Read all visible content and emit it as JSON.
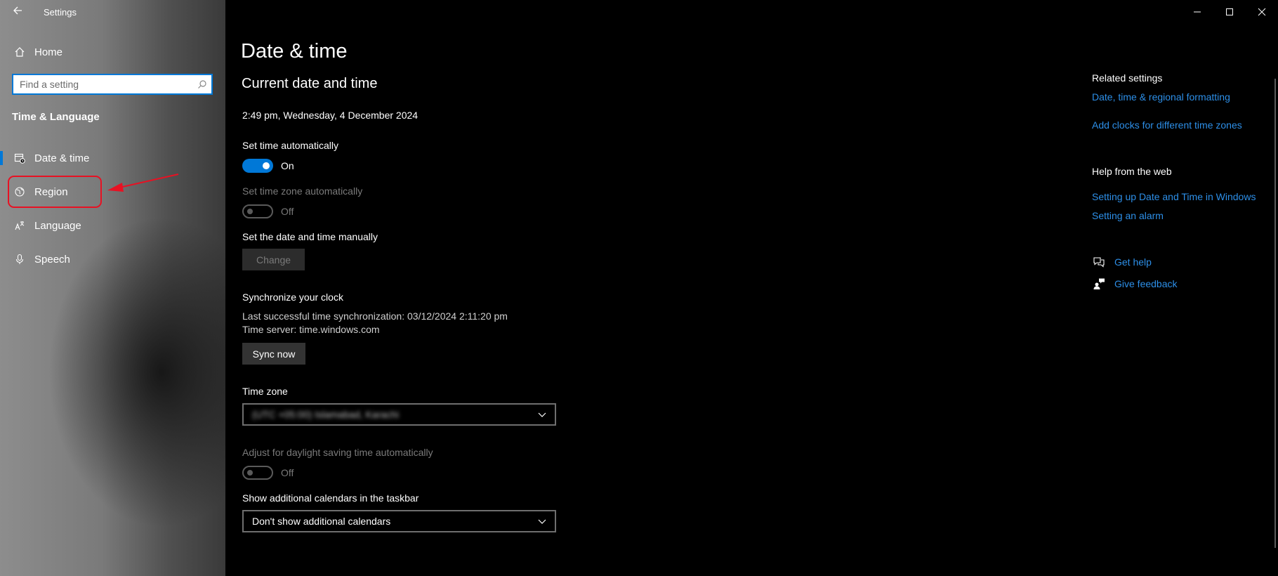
{
  "window": {
    "title": "Settings",
    "controls": {
      "minimize_icon": "minimize-icon",
      "maximize_icon": "maximize-icon",
      "close_icon": "close-icon"
    }
  },
  "sidebar": {
    "home_label": "Home",
    "search_placeholder": "Find a setting",
    "section_title": "Time & Language",
    "items": [
      {
        "label": "Date & time",
        "icon": "calendar-clock-icon",
        "active": true
      },
      {
        "label": "Region",
        "icon": "globe-icon",
        "active": false
      },
      {
        "label": "Language",
        "icon": "language-icon",
        "active": false
      },
      {
        "label": "Speech",
        "icon": "microphone-icon",
        "active": false
      }
    ]
  },
  "main": {
    "page_title": "Date & time",
    "section_title": "Current date and time",
    "current_datetime": "2:49 pm, Wednesday, 4 December 2024",
    "set_time_auto": {
      "label": "Set time automatically",
      "state": "On",
      "enabled": true,
      "on": true
    },
    "set_timezone_auto": {
      "label": "Set time zone automatically",
      "state": "Off",
      "enabled": false,
      "on": false
    },
    "manual": {
      "label": "Set the date and time manually",
      "button": "Change"
    },
    "sync": {
      "title": "Synchronize your clock",
      "last_sync": "Last successful time synchronization: 03/12/2024 2:11:20 pm",
      "server": "Time server: time.windows.com",
      "button": "Sync now"
    },
    "timezone": {
      "label": "Time zone",
      "value": "(UTC +05:00) Islamabad, Karachi"
    },
    "dst": {
      "label": "Adjust for daylight saving time automatically",
      "state": "Off",
      "enabled": false,
      "on": false
    },
    "calendars": {
      "label": "Show additional calendars in the taskbar",
      "value": "Don't show additional calendars"
    }
  },
  "related": {
    "heading": "Related settings",
    "links": [
      "Date, time & regional formatting",
      "Add clocks for different time zones"
    ],
    "help_heading": "Help from the web",
    "help_links": [
      "Setting up Date and Time in Windows",
      "Setting an alarm"
    ],
    "get_help": "Get help",
    "give_feedback": "Give feedback"
  },
  "colors": {
    "accent": "#0078d7",
    "link": "#2d8fe8",
    "annotation": "#e81123"
  }
}
